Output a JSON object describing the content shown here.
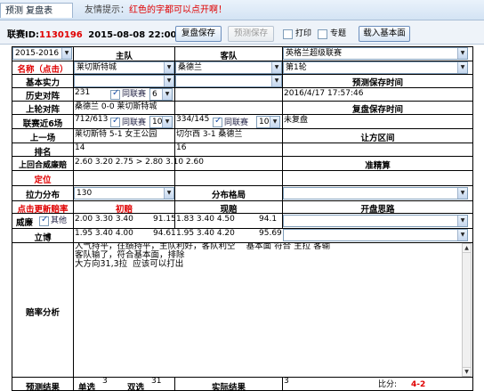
{
  "tabs": {
    "active": "预测 复盘表",
    "tip_prefix": "友情提示：",
    "tip_red": "红色的字都可以点开啊！"
  },
  "toolbar": {
    "id_label": "联赛ID:",
    "id_value": "1130196",
    "datetime": "2015-08-08 22:00",
    "save_review": "复盘保存",
    "save_predict": "预测保存",
    "print": "打印",
    "topic": "专题",
    "load_basic": "载入基本面"
  },
  "header": {
    "season": "2015-2016",
    "home_col": "主队",
    "away_col": "客队",
    "league": "英格兰超级联赛"
  },
  "labels": {
    "name": "名称（点击）",
    "basic": "基本实力",
    "history": "历史对阵",
    "last_round": "上轮对阵",
    "recent6": "联赛近6场",
    "last_match": "上一场",
    "rank": "排名",
    "last_asian": "上回合威廉赔",
    "position": "定位",
    "pull": "拉力分布",
    "distribution": "分布格局",
    "update": "点击更新赔率",
    "initial": "初赔",
    "final": "现赔",
    "open_thought": "开盘思路",
    "weilian": "威廉",
    "other": "其他",
    "libo": "立博",
    "analysis": "赔率分析",
    "predict_result": "预测结果",
    "single": "单选",
    "double": "双选",
    "actual": "实际结果",
    "ratio": "比分:",
    "pred_time": "预测保存时间",
    "review_time": "复盘保存时间",
    "handicap": "让方区间",
    "accuracy": "准精算",
    "same_league": "同联赛"
  },
  "teams": {
    "home": "莱切斯特城",
    "away": "桑德兰",
    "round": "第1轮"
  },
  "history": {
    "count": "231",
    "num": "6",
    "time": "2016/4/17 17:57:46"
  },
  "last_round": {
    "text": "桑德兰 0-0 莱切斯特城"
  },
  "recent6": {
    "home": "712/613",
    "home_n": "10",
    "away": "334/145",
    "away_n": "10",
    "review": "未复盘"
  },
  "last_match": {
    "home": "莱切斯特 5-1 女王公园",
    "away": "切尔西 3-1 桑德兰"
  },
  "rank": {
    "home": "14",
    "away": "16"
  },
  "asian": {
    "home": "2.60  3.20  2.75  > 2.80  3.10  2.60"
  },
  "pull": {
    "value": "130"
  },
  "odds": {
    "weilian_init": [
      "2.00",
      "3.30",
      "3.40",
      "91.15"
    ],
    "weilian_final": [
      "1.83",
      "3.40",
      "4.50",
      "94.1"
    ],
    "libo_init": [
      "1.95",
      "3.40",
      "4.00",
      "94.61"
    ],
    "libo_final": [
      "1.95",
      "3.40",
      "4.20",
      "95.69"
    ]
  },
  "analysis_text": "人气持平，往绩持平，主队利好，客队利空    基本面 符合 主拉 客输\n客队输了，符合基本面，排除\n大方向31,3拉  应该可以打出",
  "results": {
    "single": "3",
    "double": "31",
    "actual": "3",
    "score": "4-2"
  }
}
